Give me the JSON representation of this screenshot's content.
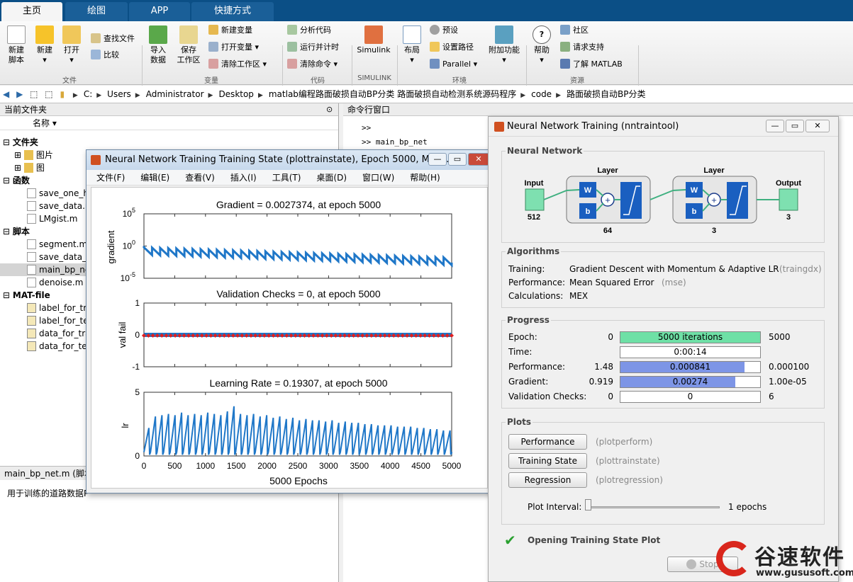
{
  "tabs": [
    "主页",
    "绘图",
    "APP",
    "快捷方式"
  ],
  "ribbon": {
    "new_script": "新建\n脚本",
    "new": "新建",
    "open": "打开",
    "find_files": "查找文件",
    "compare": "比较",
    "import": "导入\n数据",
    "save_ws": "保存\n工作区",
    "new_var": "新建变量",
    "open_var": "打开变量",
    "clear_ws": "清除工作区",
    "analyze": "分析代码",
    "run_time": "运行并计时",
    "clear_cmd": "清除命令",
    "simulink": "Simulink",
    "layout": "布局",
    "prefs": "预设",
    "set_path": "设置路径",
    "parallel": "Parallel",
    "addons": "附加功能",
    "help": "帮助",
    "community": "社区",
    "request_support": "请求支持",
    "learn": "了解 MATLAB",
    "sections": [
      "文件",
      "变量",
      "代码",
      "SIMULINK",
      "环境",
      "资源"
    ]
  },
  "breadcrumb": [
    "C:",
    "Users",
    "Administrator",
    "Desktop",
    "matlab编程路面破损自动BP分类 路面破损自动检测系统源码程序",
    "code",
    "路面破损自动BP分类"
  ],
  "left": {
    "title": "当前文件夹",
    "col": "名称",
    "groups": {
      "folder": "文件夹",
      "func": "函数",
      "script": "脚本",
      "mat": "MAT-file"
    },
    "folders": [
      "图片",
      "图"
    ],
    "funcs": [
      "save_one_h",
      "save_data.m",
      "LMgist.m"
    ],
    "scripts": [
      "segment.m",
      "save_data_",
      "main_bp_ne",
      "denoise.m"
    ],
    "mats": [
      "label_for_tr",
      "label_for_te",
      "data_for_tra",
      "data_for_te"
    ],
    "detail_file": "main_bp_net.m",
    "detail_tag": "(脚本",
    "detail_text": "用于训练的道路数据P"
  },
  "cmd": {
    "title": "命令行窗口",
    "l1": ">>",
    "l2": ">> main_bp_net"
  },
  "ptw": {
    "title": "Neural Network Training Training State (plottrainstate), Epoch 5000, Maxi...",
    "menu": [
      "文件(F)",
      "编辑(E)",
      "查看(V)",
      "插入(I)",
      "工具(T)",
      "桌面(D)",
      "窗口(W)",
      "帮助(H)"
    ],
    "g_title": "Gradient = 0.0027374, at epoch 5000",
    "g_ylabel": "gradient",
    "v_title": "Validation Checks = 0, at epoch 5000",
    "v_ylabel": "val fail",
    "l_title": "Learning Rate = 0.19307, at epoch 5000",
    "l_ylabel": "lr",
    "xlabel": "5000 Epochs"
  },
  "chart_data": [
    {
      "type": "line",
      "title": "Gradient = 0.0027374, at epoch 5000",
      "ylabel": "gradient",
      "yscale": "log",
      "ylim": [
        1e-05,
        100000
      ],
      "yticks": [
        "10^5",
        "10^0",
        "10^-5"
      ],
      "xlim": [
        0,
        5000
      ],
      "sawtooth_teeth": 38,
      "x": [
        0,
        5000
      ],
      "y": [
        1.0,
        0.0027374
      ]
    },
    {
      "type": "scatter",
      "title": "Validation Checks = 0, at epoch 5000",
      "ylabel": "val fail",
      "ylim": [
        -1,
        1
      ],
      "yticks": [
        "1",
        "0",
        "-1"
      ],
      "xlim": [
        0,
        5000
      ],
      "x": [
        0,
        5000
      ],
      "y": [
        0,
        0
      ]
    },
    {
      "type": "line",
      "title": "Learning Rate = 0.19307, at epoch 5000",
      "ylabel": "lr",
      "xlabel": "5000 Epochs",
      "ylim": [
        0,
        5
      ],
      "yticks": [
        "5",
        "0"
      ],
      "xlim": [
        0,
        5000
      ],
      "xticks": [
        "0",
        "500",
        "1000",
        "1500",
        "2000",
        "2500",
        "3000",
        "3500",
        "4000",
        "4500",
        "5000"
      ],
      "peaks": [
        2.2,
        3.1,
        3.2,
        3.3,
        3.2,
        3.4,
        3.2,
        3.3,
        3.2,
        3.4,
        3.3,
        3.2,
        3.5,
        3.9,
        3.3,
        3.2,
        3.3,
        3.1,
        3.2,
        3.0,
        3.1,
        2.9,
        3.0,
        2.8,
        2.9,
        2.8,
        2.8,
        2.7,
        2.8,
        2.6,
        2.7,
        2.6,
        2.6,
        2.5,
        2.5,
        2.4,
        2.4,
        2.4,
        2.3,
        2.3,
        2.3,
        2.2,
        2.2,
        2.1,
        2.1,
        2.0,
        2.0
      ],
      "final": 0.19307
    }
  ],
  "nnt": {
    "title": "Neural Network Training (nntraintool)",
    "nn_title": "Neural Network",
    "layer": "Layer",
    "input": "Input",
    "input_n": "512",
    "output": "Output",
    "output_n": "3",
    "l1_n": "64",
    "l2_n": "3",
    "w": "W",
    "b": "b",
    "alg_title": "Algorithms",
    "alg": [
      [
        "Training:",
        "Gradient Descent with Momentum & Adaptive LR",
        "(traingdx)"
      ],
      [
        "Performance:",
        "Mean Squared Error",
        "(mse)"
      ],
      [
        "Calculations:",
        "MEX",
        ""
      ]
    ],
    "prog_title": "Progress",
    "prog": [
      {
        "label": "Epoch:",
        "start": "0",
        "value": "5000 iterations",
        "end": "5000",
        "fill": 1.0,
        "color": "#6ee0a6"
      },
      {
        "label": "Time:",
        "start": "",
        "value": "0:00:14",
        "end": "",
        "fill": 0,
        "color": "#ffffff"
      },
      {
        "label": "Performance:",
        "start": "1.48",
        "value": "0.000841",
        "end": "0.000100",
        "fill": 0.89,
        "color": "#7d95e6"
      },
      {
        "label": "Gradient:",
        "start": "0.919",
        "value": "0.00274",
        "end": "1.00e-05",
        "fill": 0.82,
        "color": "#7d95e6"
      },
      {
        "label": "Validation Checks:",
        "start": "0",
        "value": "0",
        "end": "6",
        "fill": 0,
        "color": "#ffffff"
      }
    ],
    "plots_title": "Plots",
    "plots": [
      [
        "Performance",
        "(plotperform)"
      ],
      [
        "Training State",
        "(plottrainstate)"
      ],
      [
        "Regression",
        "(plotregression)"
      ]
    ],
    "interval_label": "Plot Interval:",
    "interval_val": "1 epochs",
    "status": "Opening Training State Plot",
    "stop": "Stop"
  },
  "watermark": {
    "name": "谷速软件",
    "url": "www.gususoft.com"
  },
  "colors": {
    "tab_bg": "#0b4f86",
    "plot_blue": "#1f77c8",
    "val_red": "#e02020",
    "prog_green": "#6ee0a6",
    "prog_blue": "#7d95e6"
  }
}
